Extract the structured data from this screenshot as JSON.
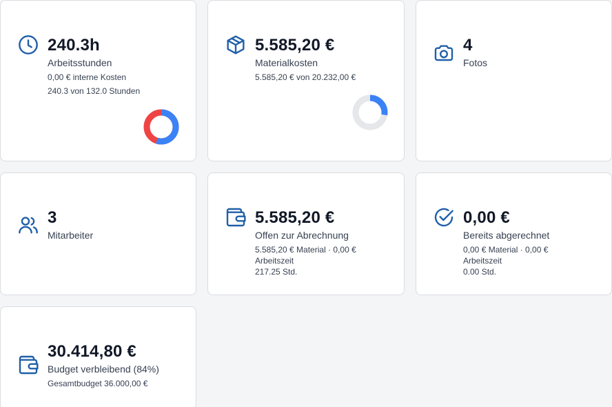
{
  "colors": {
    "accent": "#1f5fa8",
    "donut_blue": "#3b82f6",
    "donut_red": "#ef4444",
    "donut_gray": "#e5e7eb"
  },
  "cards": {
    "hours": {
      "icon": "clock-icon",
      "value": "240.3h",
      "label": "Arbeitsstunden",
      "sub1": "0,00 € interne Kosten",
      "sub2": "240.3 von 132.0 Stunden",
      "donut_blue_fraction": 0.55
    },
    "material": {
      "icon": "package-icon",
      "value": "5.585,20 €",
      "label": "Materialkosten",
      "sub1": "5.585,20 € von 20.232,00 €",
      "donut_blue_fraction": 0.276
    },
    "photos": {
      "icon": "camera-icon",
      "value": "4",
      "label": "Fotos"
    },
    "staff": {
      "icon": "users-icon",
      "value": "3",
      "label": "Mitarbeiter"
    },
    "open": {
      "icon": "wallet-icon",
      "value": "5.585,20 €",
      "label": "Offen zur Abrechnung",
      "sub1": "5.585,20 € Material · 0,00 €",
      "sub2": "Arbeitszeit",
      "sub3": "217.25 Std."
    },
    "billed": {
      "icon": "check-circle-icon",
      "value": "0,00 €",
      "label": "Bereits abgerechnet",
      "sub1": "0,00 € Material · 0,00 €",
      "sub2": "Arbeitszeit",
      "sub3": "0.00 Std."
    },
    "budget": {
      "icon": "wallet-icon",
      "value": "30.414,80 €",
      "label": "Budget verbleibend (84%)",
      "sub1": "Gesamtbudget 36.000,00 €"
    }
  }
}
